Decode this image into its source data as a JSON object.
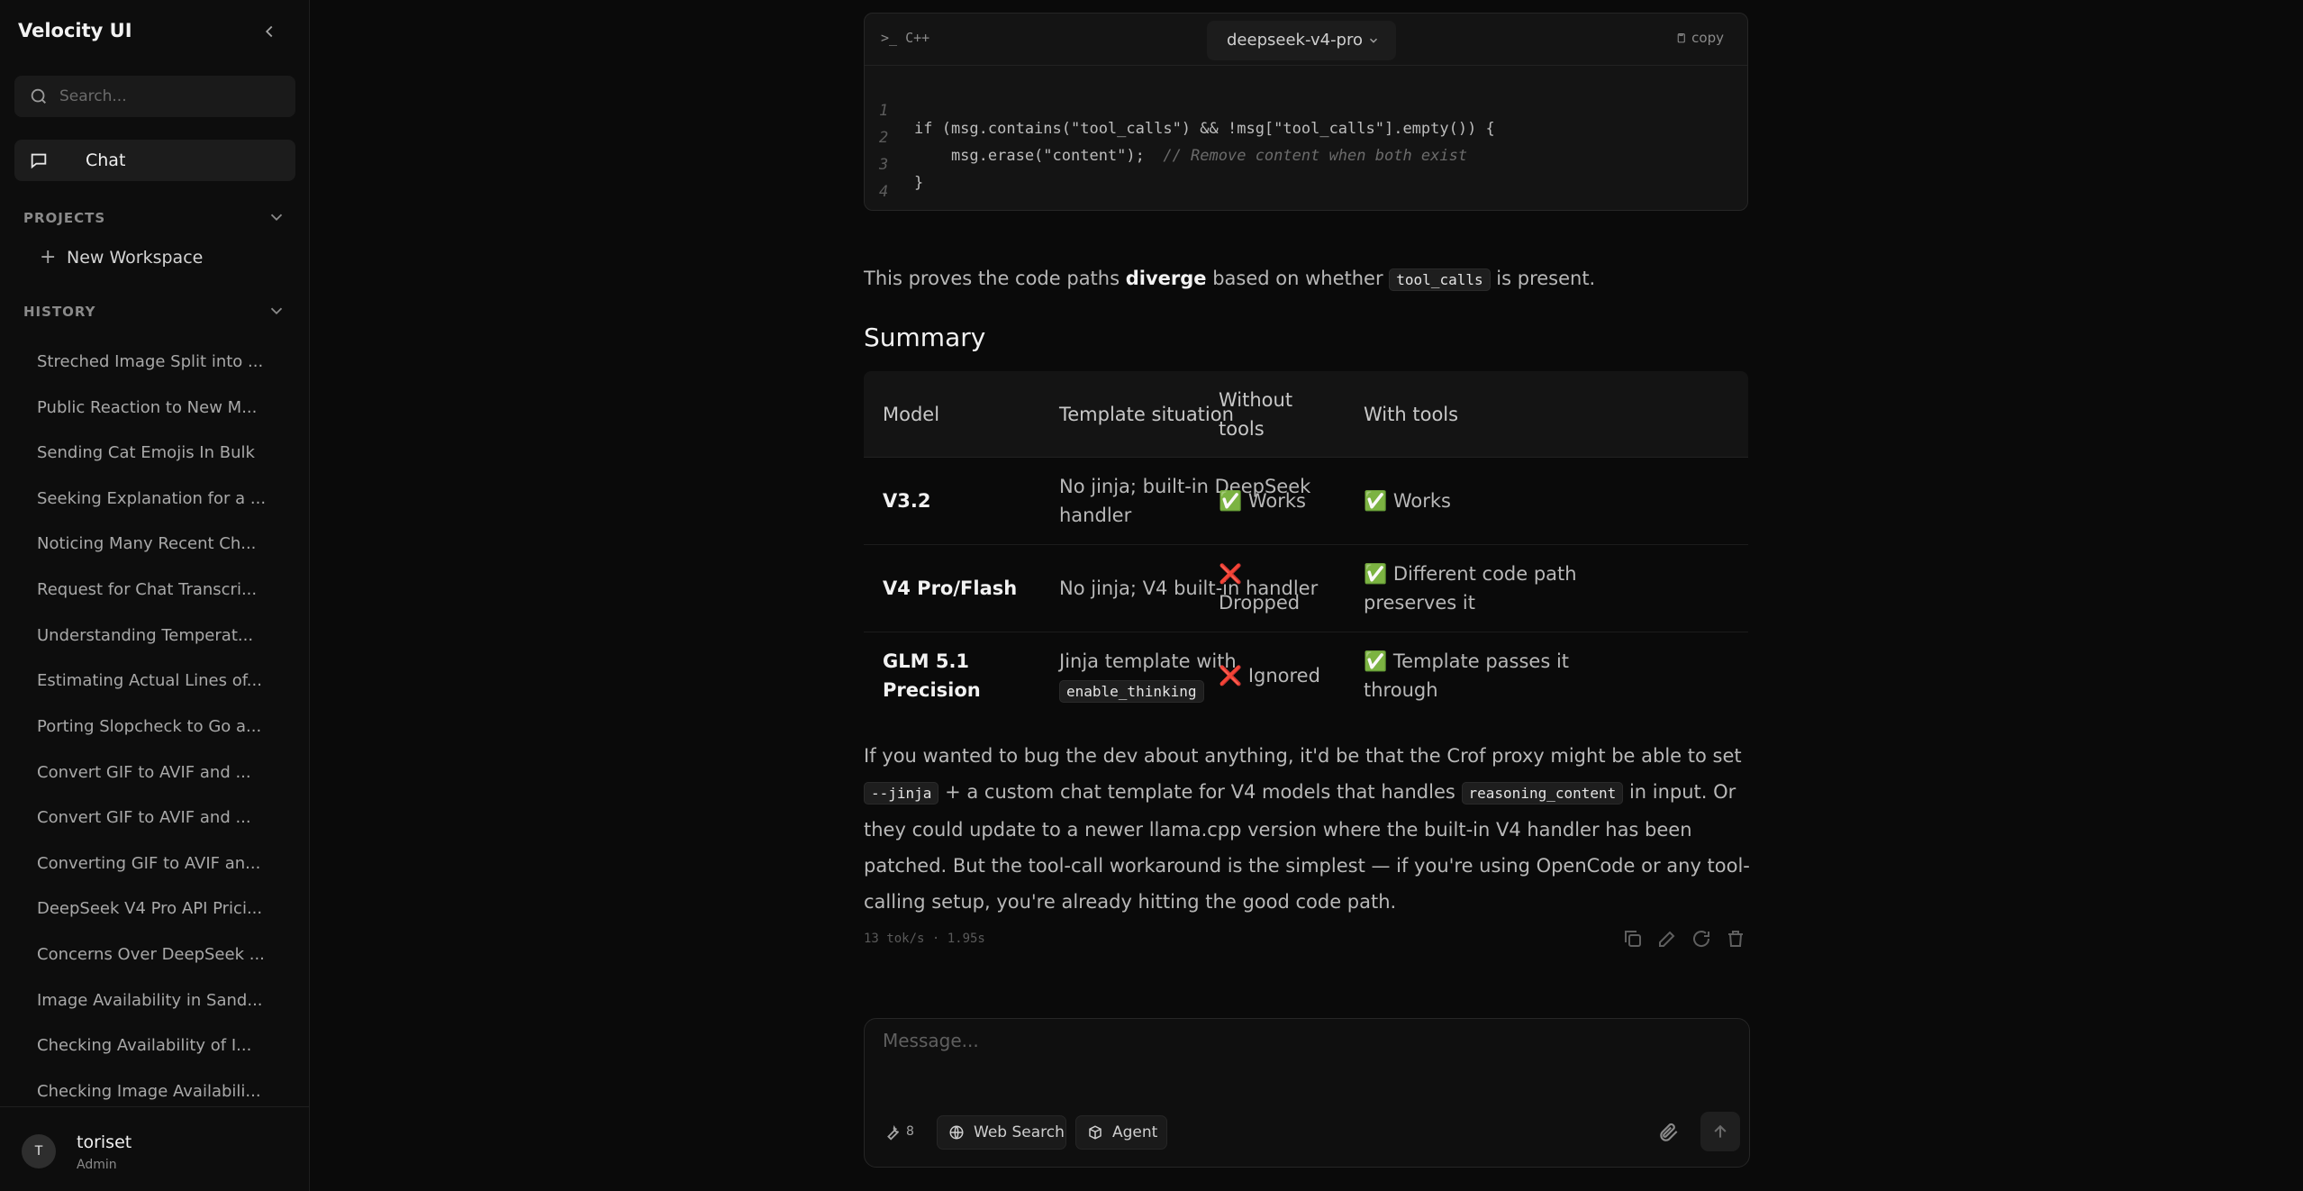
{
  "app": {
    "title": "Velocity UI"
  },
  "sidebar": {
    "search_placeholder": "Search...",
    "chat_label": "Chat",
    "projects_header": "PROJECTS",
    "new_workspace": "New Workspace",
    "history_header": "HISTORY",
    "history": [
      "Streched Image Split into ...",
      "Public Reaction to New M...",
      "Sending Cat Emojis In Bulk",
      "Seeking Explanation for a ...",
      "Noticing Many Recent Ch...",
      "Request for Chat Transcri...",
      "Understanding Temperat...",
      "Estimating Actual Lines of...",
      "Porting Slopcheck to Go a...",
      "Convert GIF to AVIF and ...",
      "Convert GIF to AVIF and ...",
      "Converting GIF to AVIF an...",
      "DeepSeek V4 Pro API Prici...",
      "Concerns Over DeepSeek ...",
      "Image Availability in Sand...",
      "Checking Availability of I...",
      "Checking Image Availabili..."
    ],
    "user": {
      "initial": "T",
      "name": "toriset",
      "role": "Admin"
    }
  },
  "code_block": {
    "language": "C++",
    "model": "deepseek-v4-pro",
    "copy_label": "copy",
    "lines": [
      {
        "n": "1",
        "code": "if (msg.contains(\"tool_calls\") && !msg[\"tool_calls\"].empty()) {",
        "comment": ""
      },
      {
        "n": "2",
        "code": "    msg.erase(\"content\");  ",
        "comment": "// Remove content when both exist"
      },
      {
        "n": "3",
        "code": "}",
        "comment": ""
      },
      {
        "n": "4",
        "code": "",
        "comment": ""
      }
    ]
  },
  "message": {
    "para1_pre": "This proves the code paths ",
    "para1_bold": "diverge",
    "para1_mid": " based on whether ",
    "para1_code": "tool_calls",
    "para1_post": " is present.",
    "summary_heading": "Summary",
    "table": {
      "headers": [
        "Model",
        "Template situation",
        "Without tools",
        "With tools"
      ],
      "rows": [
        {
          "model": "V3.2",
          "template": "No jinja; built-in DeepSeek handler",
          "template_code": "",
          "without": "✅ Works",
          "with": "✅ Works"
        },
        {
          "model": "V4 Pro/Flash",
          "template": "No jinja; V4 built-in handler",
          "template_code": "",
          "without": "❌ Dropped",
          "with": "✅ Different code path preserves it"
        },
        {
          "model": "GLM 5.1 Precision",
          "template": "Jinja template with",
          "template_code": "enable_thinking",
          "without": "❌ Ignored",
          "with": "✅ Template passes it through"
        }
      ]
    },
    "para2_a": "If you wanted to bug the dev about anything, it'd be that the Crof proxy might be able to set ",
    "para2_code1": "--jinja",
    "para2_b": " + a custom chat template for V4 models that handles ",
    "para2_code2": "reasoning_content",
    "para2_c": " in input. Or they could update to a newer llama.cpp version where the built-in V4 handler has been patched. But the tool-call workaround is the simplest — if you're using OpenCode or any tool-calling setup, you're already hitting the good code path.",
    "stats": "13 tok/s · 1.95s"
  },
  "composer": {
    "placeholder": "Message...",
    "tools_count": "8",
    "web_search": "Web Search",
    "agent": "Agent"
  }
}
